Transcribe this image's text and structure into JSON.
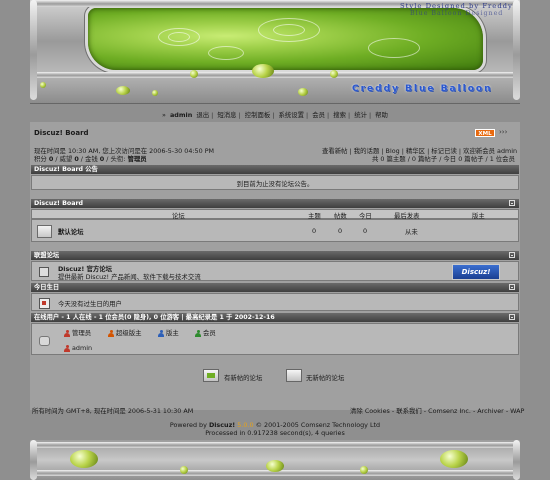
{
  "banner": {
    "tagline": "Style Designed by Freddy",
    "tagline2": "Blue Balloon Designed",
    "logo_text": "Creddy Blue Balloon"
  },
  "nav": {
    "user_prefix": "» ",
    "username": "admin",
    "items": [
      "退出",
      "短消息",
      "控制面板",
      "系统设置",
      "会员",
      "搜索",
      "统计",
      "帮助"
    ]
  },
  "board": {
    "title": "Discuz! Board",
    "xml_badge": "XML",
    "more_icon": "›››"
  },
  "status": {
    "line1": "现在时间是 10:30 AM, 您上次访问是在 2006-5-30 04:50 PM",
    "line2_prefix": "积分 ",
    "points": "0",
    "line2_mid1": " / 威望 ",
    "prestige": "0",
    "line2_mid2": " / 金钱 ",
    "money": "0",
    "line2_mid3": " / 头衔: ",
    "rank": "管理员",
    "links": "查看新帖 | 我的话题 | Blog | 精华区 | 标记已读 | 欢迎新会员  admin",
    "stats": "共 0 篇主题 / 0 篇帖子 / 今日 0 篇帖子 / 1 位会员"
  },
  "announcement": {
    "header": "Discuz! Board 公告",
    "text": "到目前为止没有论坛公告。"
  },
  "forum_section": {
    "header": "Discuz! Board",
    "columns": [
      "论坛",
      "主题",
      "帖数",
      "今日",
      "最后发表",
      "版主"
    ],
    "rows": [
      {
        "name": "默认论坛",
        "topics": "0",
        "posts": "0",
        "today": "0",
        "last_post": "从未",
        "moderator": ""
      }
    ]
  },
  "links_section": {
    "header": "联盟论坛",
    "title": "Discuz! 官方论坛",
    "desc": "提供最新 Discuz! 产品新闻、软件下载与技术交流",
    "logo_text": "Discuz!"
  },
  "birthday": {
    "header": "今日生日",
    "text": "今天没有过生日的用户"
  },
  "online": {
    "header": "在线用户 - 1 人在线 - 1 位会员(0 隐身), 0 位游客 | 最高纪录是 1 于 2002-12-16",
    "legend": [
      "管理员",
      "超级版主",
      "版主",
      "会员"
    ],
    "legend_colors": [
      "#c0392b",
      "#d35400",
      "#2c5fb8",
      "#2e8b2e"
    ],
    "users": [
      "admin"
    ]
  },
  "legend_icons": {
    "new": "有新帖的论坛",
    "nonew": "无新帖的论坛"
  },
  "footer": {
    "timezone": "所有时间为  GMT+8, 现在时间是  2006-5-31 10:30 AM",
    "links": "清除 Cookies - 联系我们 - Comsenz Inc. - Archiver - WAP",
    "powered_prefix": "Powered by ",
    "powered_name": "Discuz!",
    "version": "5.0.0",
    "copyright": "© 2001-2005 Comsenz Technology Ltd",
    "processed": "Processed in 0.917238 second(s), 4 queries"
  }
}
